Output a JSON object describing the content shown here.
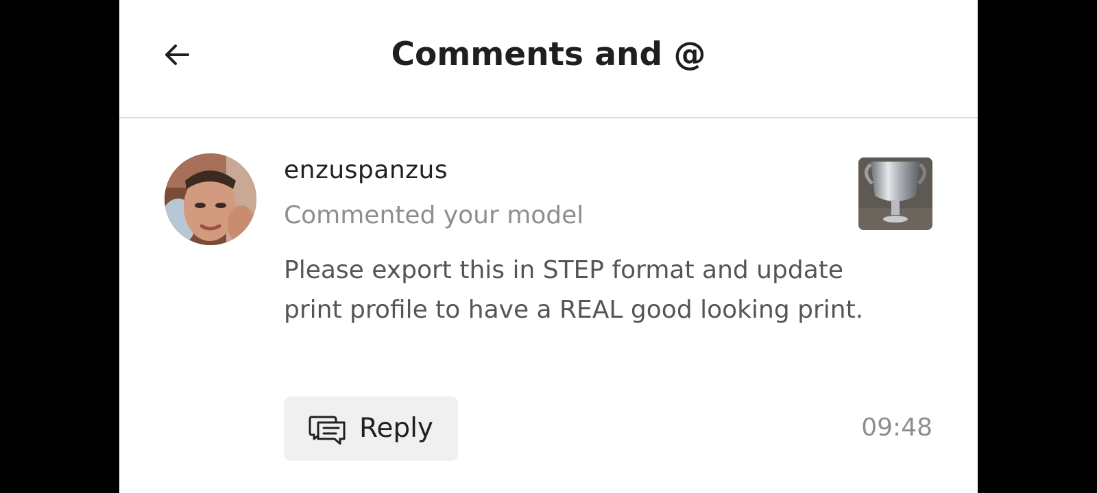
{
  "header": {
    "title": "Comments and @",
    "back_icon": "arrow-left-icon"
  },
  "notification": {
    "username": "enzuspanzus",
    "action": "Commented your model",
    "comment_lines": [
      "Please export this in STEP format and update",
      "print profile to have a REAL good looking print."
    ],
    "thumbnail": "model-thumbnail-trophy-cup",
    "reply_label": "Reply",
    "reply_icon": "chat-bubbles-icon",
    "time": "09:48"
  },
  "colors": {
    "background": "#ffffff",
    "title": "#1f1f1f",
    "secondary_text": "#8e8e8e",
    "comment_text": "#555555",
    "reply_button_bg": "#f0f0f0",
    "divider": "#dedede"
  }
}
